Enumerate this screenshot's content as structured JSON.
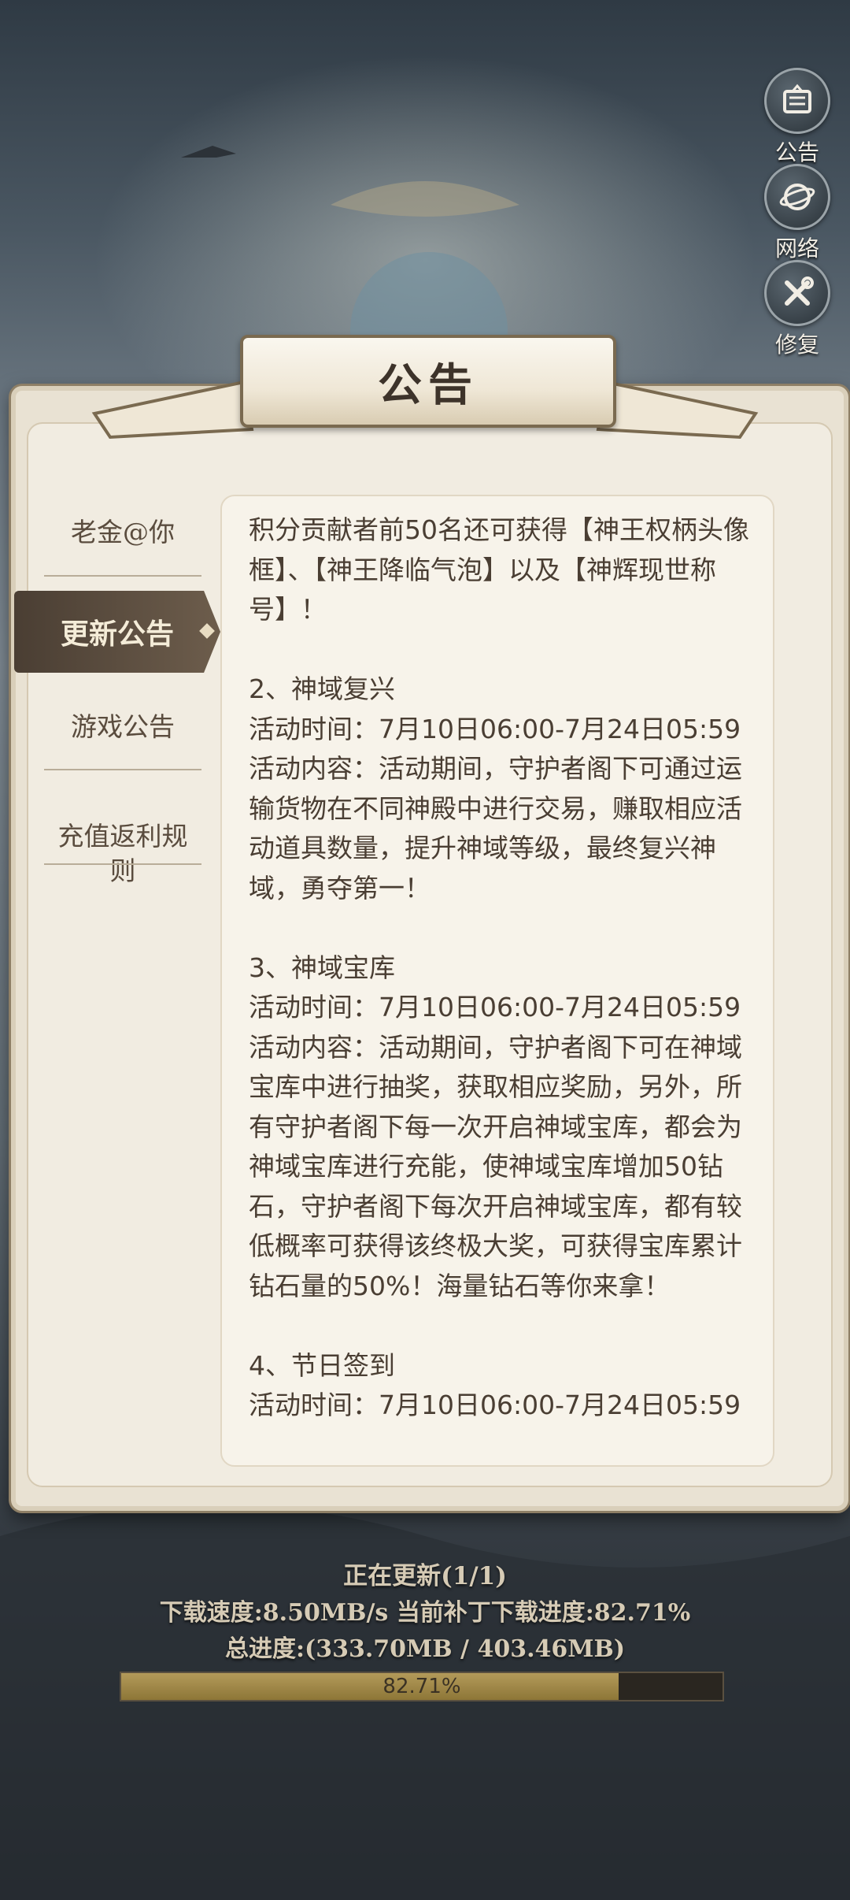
{
  "side_buttons": [
    {
      "label": "公告",
      "icon": "notice-board-icon"
    },
    {
      "label": "网络",
      "icon": "network-globe-icon"
    },
    {
      "label": "修复",
      "icon": "repair-tools-icon"
    }
  ],
  "panel": {
    "title": "公告"
  },
  "tabs": [
    {
      "label": "老金@你",
      "active": false
    },
    {
      "label": "更新公告",
      "active": true
    },
    {
      "label": "游戏公告",
      "active": false
    },
    {
      "label": "充值返利规\n则",
      "active": false
    }
  ],
  "content": {
    "text": "积分贡献者前50名还可获得【神王权柄头像框】、【神王降临气泡】以及【神辉现世称号】！\n\n2、神域复兴\n活动时间：7月10日06:00-7月24日05:59\n活动内容：活动期间，守护者阁下可通过运输货物在不同神殿中进行交易，赚取相应活动道具数量，提升神域等级，最终复兴神域，勇夺第一！\n\n3、神域宝库\n活动时间：7月10日06:00-7月24日05:59\n活动内容：活动期间，守护者阁下可在神域宝库中进行抽奖，获取相应奖励，另外，所有守护者阁下每一次开启神域宝库，都会为神域宝库进行充能，使神域宝库增加50钻石，守护者阁下每次开启神域宝库，都有较低概率可获得该终极大奖，可获得宝库累计钻石量的50%！海量钻石等你来拿！\n\n4、节日签到\n活动时间：7月10日06:00-7月24日05:59"
  },
  "update": {
    "status": "正在更新(1/1)",
    "speed_line": "下载速度:8.50MB/s 当前补丁下载进度:82.71%",
    "total_line": "总进度:(333.70MB / 403.46MB)",
    "progress_label": "82.71%",
    "progress_percent": 82.71
  },
  "colors": {
    "panel_bg": "#f1ece1",
    "text": "#4a3e33",
    "accent_tab": "#5a4a3c",
    "progress_fill": "#a48b4a"
  }
}
